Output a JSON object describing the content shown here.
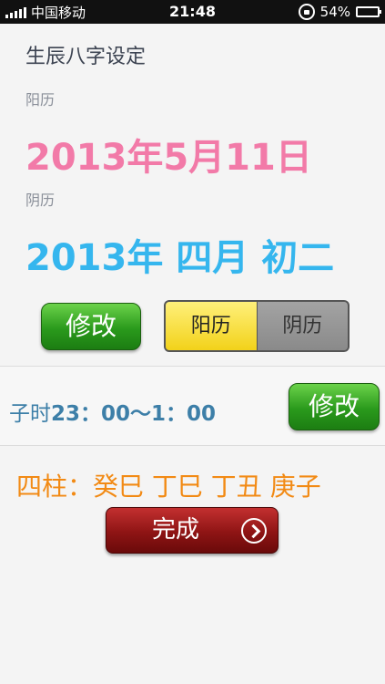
{
  "status_bar": {
    "carrier": "中国移动",
    "time": "21:48",
    "battery": "54%",
    "icons": [
      "signal-icon",
      "lock-rotation-icon",
      "battery-icon"
    ]
  },
  "page": {
    "title": "生辰八字设定"
  },
  "solar": {
    "label": "阳历",
    "date": "2013年5月11日"
  },
  "lunar": {
    "label": "阴历",
    "date": "2013年 四月 初二"
  },
  "calendar_controls": {
    "modify_label": "修改",
    "segments": [
      "阳历",
      "阴历"
    ],
    "selected": "阳历"
  },
  "time_row": {
    "prefix": "子时",
    "range": "23：00～1：00",
    "modify_label": "修改"
  },
  "pillars": {
    "text": "四柱：癸巳 丁巳 丁丑 庚子"
  },
  "done": {
    "label": "完成"
  },
  "colors": {
    "solar_accent": "#f27aa8",
    "lunar_accent": "#35b6ee",
    "pillars_accent": "#f28a14",
    "done_button": "#8e1414",
    "modify_button": "#2a9a1c"
  }
}
